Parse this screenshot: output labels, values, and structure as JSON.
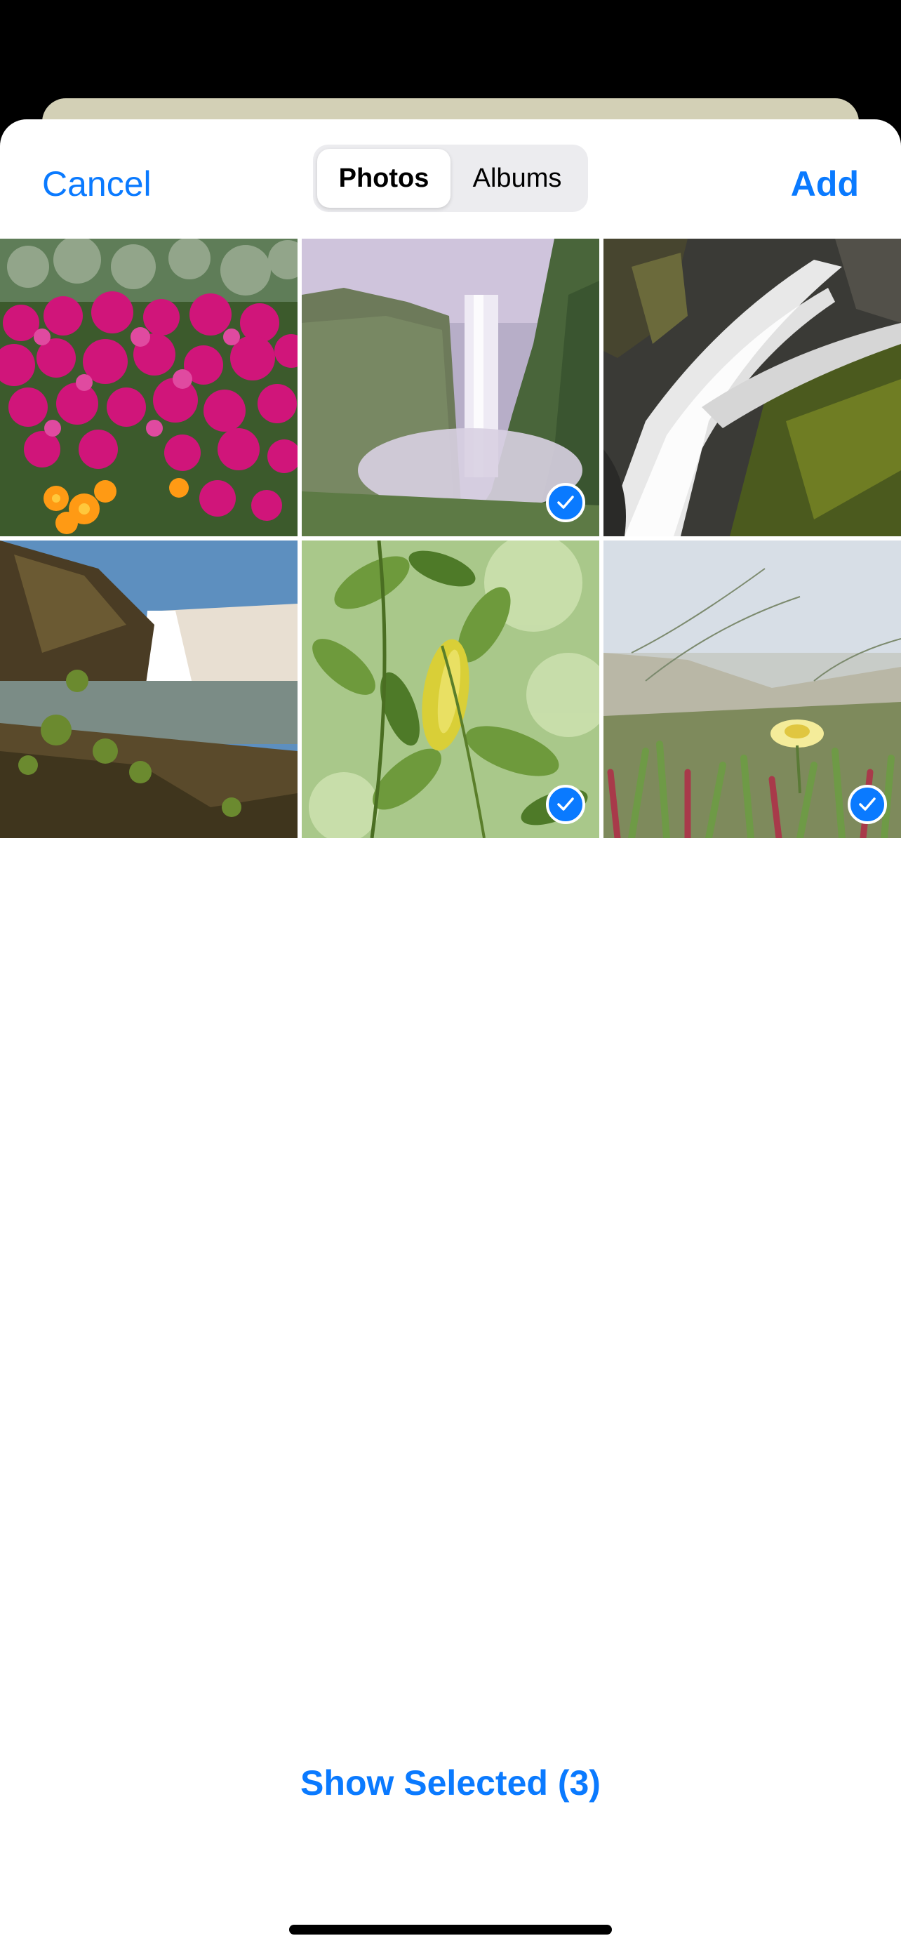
{
  "nav": {
    "cancel_label": "Cancel",
    "add_label": "Add",
    "tabs": [
      {
        "label": "Photos",
        "active": true
      },
      {
        "label": "Albums",
        "active": false
      }
    ]
  },
  "photos": [
    {
      "subject": "pink flowers",
      "selected": false
    },
    {
      "subject": "waterfall in misty gorge",
      "selected": true
    },
    {
      "subject": "waterfall over mossy rocks",
      "selected": false
    },
    {
      "subject": "waterfall at rocky shore",
      "selected": false
    },
    {
      "subject": "green leaves",
      "selected": true
    },
    {
      "subject": "yellow flower in grass",
      "selected": true
    }
  ],
  "footer": {
    "show_selected_label": "Show Selected (3)"
  },
  "colors": {
    "accent": "#0a7aff"
  }
}
